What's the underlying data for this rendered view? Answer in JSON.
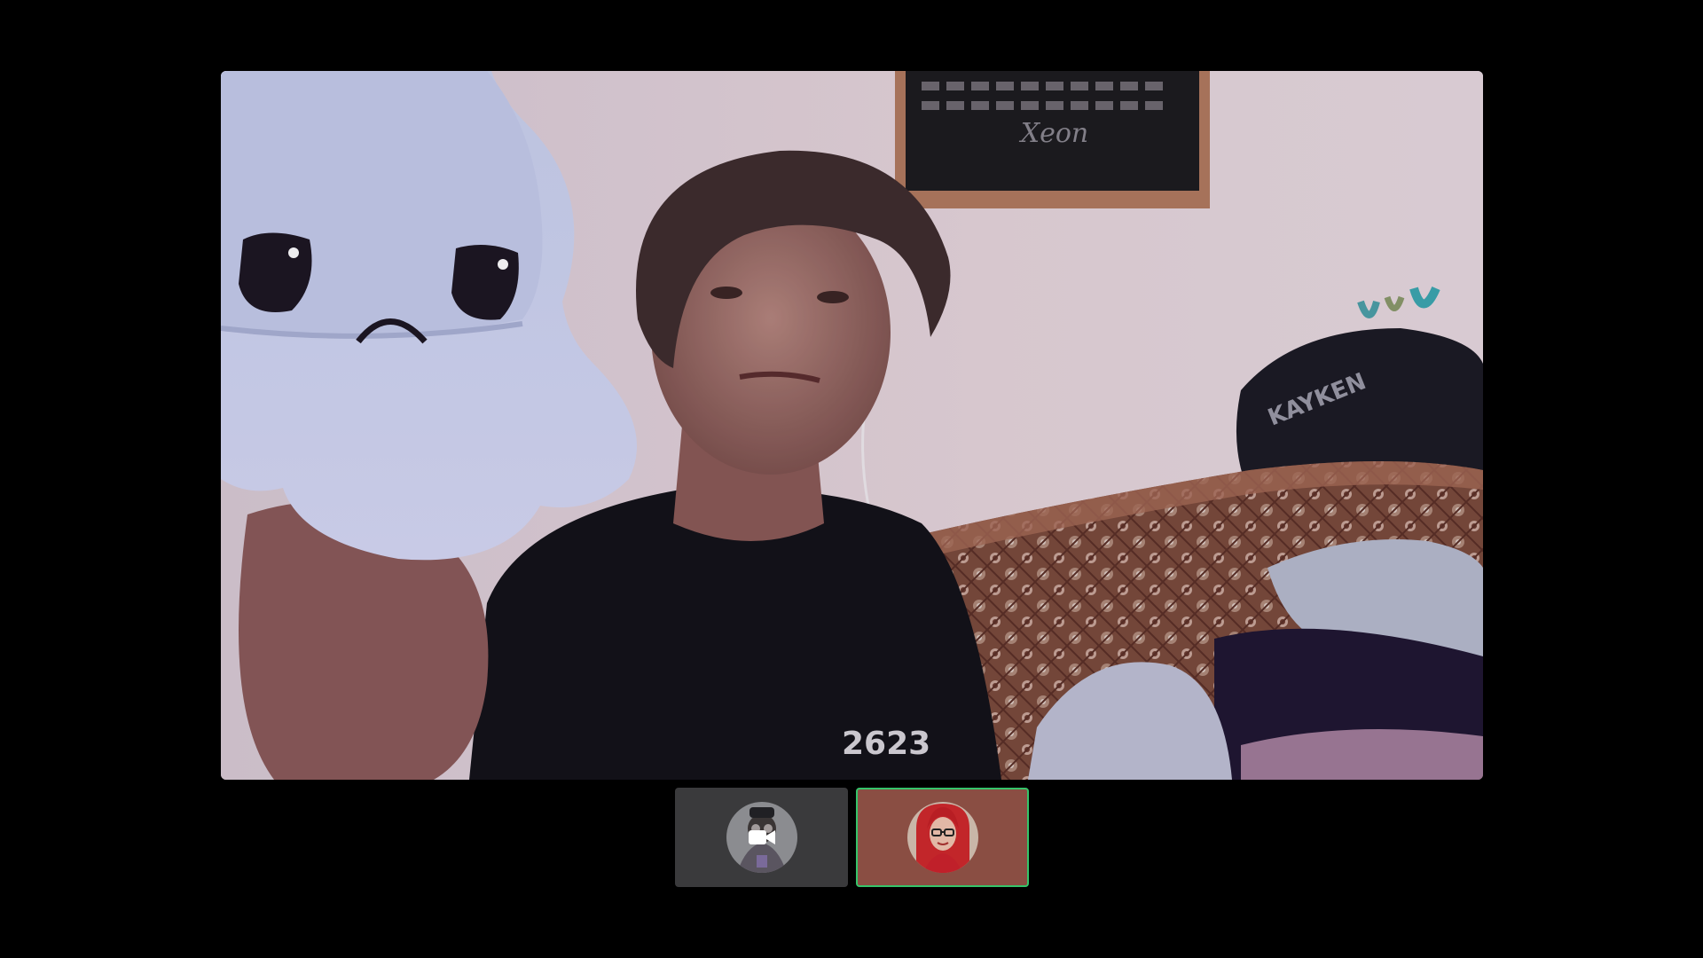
{
  "call": {
    "main_participant": {
      "shirt_text": "2623",
      "sign_text": "Xeon"
    },
    "participants": [
      {
        "id": "participant-1",
        "camera_state": "video-camera-icon",
        "tile_color": "#3a3a3c",
        "active": false
      },
      {
        "id": "participant-2",
        "camera_state": "avatar",
        "tile_color": "#8a4e43",
        "active": true
      }
    ],
    "colors": {
      "background": "#000000",
      "active_speaker_border": "#35c46a"
    }
  }
}
